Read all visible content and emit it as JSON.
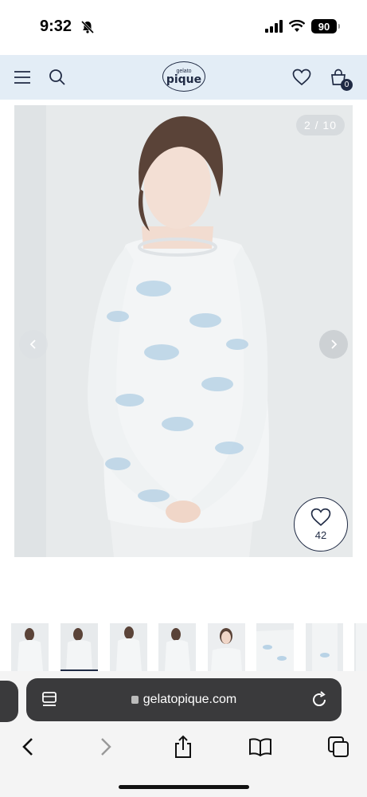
{
  "status_bar": {
    "time": "9:32",
    "battery": "90",
    "icons": [
      "bell-slash-icon",
      "cellular-signal-icon",
      "wifi-icon",
      "battery-icon"
    ]
  },
  "header": {
    "logo_top": "gelato",
    "logo_main": "pique",
    "cart_count": "0",
    "icons": [
      "hamburger-menu-icon",
      "search-icon",
      "heart-icon",
      "shopping-bag-icon"
    ],
    "colors": {
      "header_bg": "#e3edf6",
      "brand": "#1f2a44"
    }
  },
  "gallery": {
    "counter": "2 / 10",
    "favorite_count": "42",
    "icons": [
      "chevron-left-icon",
      "chevron-right-icon",
      "heart-outline-icon"
    ]
  },
  "thumbnails": {
    "count": 8,
    "active_index": 1
  },
  "browser": {
    "url": "gelatopique.com",
    "icons": [
      "tab-overview-icon",
      "lock-icon",
      "reload-icon",
      "back-icon",
      "forward-icon",
      "share-icon",
      "bookmarks-icon",
      "tabs-icon"
    ]
  }
}
